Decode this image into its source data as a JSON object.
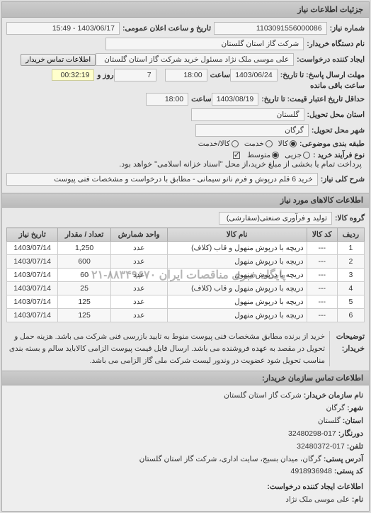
{
  "header": {
    "title": "جزئیات اطلاعات نیاز"
  },
  "info": {
    "number_label": "شماره نیاز:",
    "number": "1103091556000086",
    "pubdate_label": "تاریخ و ساعت اعلان عمومی:",
    "pubdate": "1403/06/17 - 15:49",
    "buyer_label": "نام دستگاه خریدار:",
    "buyer": "شرکت گاز استان گلستان",
    "requester_label": "ایجاد کننده درخواست:",
    "requester": "علی موسی ملک نژاد مسئول خرید شرکت گاز استان گلستان",
    "buyer_contact_btn": "اطلاعات تماس خریدار",
    "deadline_from_label": "مهلت ارسال پاسخ: تا تاریخ:",
    "deadline_date": "1403/06/24",
    "hour_label": "ساعت",
    "deadline_hour": "18:00",
    "days_remain": "7",
    "days_remain_label": "روز و",
    "countdown": "00:32:19",
    "countdown_label": "ساعت باقی مانده",
    "valid_label": "حداقل تاریخ اعتبار قیمت: تا تاریخ:",
    "valid_date": "1403/08/19",
    "valid_hour": "18:00",
    "province_label": "استان محل تحویل:",
    "province": "گلستان",
    "city_label": "شهر محل تحویل:",
    "city": "گرگان",
    "pack_label": "طبقه بندی موضوعی:",
    "pack_opts": {
      "all": "کالا",
      "goods": "خدمت",
      "service": "کالا/خدمت"
    },
    "buytype_label": "نوع فرآیند خرید :",
    "buytype_opts": {
      "small": "جزیی",
      "medium": "متوسط"
    },
    "buytype_note": "پرداخت تمام یا بخشی از مبلغ خرید،از محل \"اسناد خزانه اسلامی\" خواهد بود.",
    "summary_label": "شرح کلی نیاز:",
    "summary": "خرید 6 قلم درپوش و فرم نانو سیمانی - مطابق با درخواست و مشخصات فنی پیوست"
  },
  "goods": {
    "section_title": "اطلاعات کالاهای مورد نیاز",
    "group_label": "گروه کالا:",
    "group": "تولید و فرآوری صنعتی(سفارشی)",
    "columns": [
      "ردیف",
      "کد کالا",
      "نام کالا",
      "واحد شمارش",
      "تعداد / مقدار",
      "تاریخ نیاز"
    ],
    "rows": [
      {
        "n": "1",
        "code": "---",
        "name": "دریچه با درپوش منهول و قاب (کلاف)",
        "unit": "عدد",
        "qty": "1,250",
        "date": "1403/07/14"
      },
      {
        "n": "2",
        "code": "---",
        "name": "دریچه با درپوش منهول",
        "unit": "عدد",
        "qty": "600",
        "date": "1403/07/14"
      },
      {
        "n": "3",
        "code": "---",
        "name": "دریچه با درپوش منهول",
        "unit": "عدد",
        "qty": "60",
        "date": "1403/07/14"
      },
      {
        "n": "4",
        "code": "---",
        "name": "دریچه با درپوش منهول و قاب (کلاف)",
        "unit": "عدد",
        "qty": "25",
        "date": "1403/07/14"
      },
      {
        "n": "5",
        "code": "---",
        "name": "دریچه با درپوش منهول",
        "unit": "عدد",
        "qty": "125",
        "date": "1403/07/14"
      },
      {
        "n": "6",
        "code": "---",
        "name": "دریچه با درپوش منهول",
        "unit": "عدد",
        "qty": "125",
        "date": "1403/07/14"
      }
    ],
    "watermark": "پایگاه خبری مناقصات ایران ۸۸۳۴۹۶۷۰-۰۲۱"
  },
  "notes": {
    "label": "توضیحات خریدار:",
    "text": "خرید از برنده مطابق مشخصات فنی پیوست منوط به تایید بازرسی فنی شرکت می باشد. هزینه حمل و تحویل در مقصد به عهده فروشنده می باشد. ارسال فایل قیمت پیوست الزامی کالاباید سالم و بسته بندی مناسب تحویل شود عضویت در وندور لیست شرکت ملی گاز الزامی می باشد."
  },
  "contact": {
    "title": "اطلاعات تماس سازمان خریدار:",
    "org_label": "نام سازمان خریدار:",
    "org": "شرکت گاز استان گلستان",
    "city_label": "شهر:",
    "city": "گرگان",
    "province_label": "استان:",
    "province": "گلستان",
    "fax_label": "دورنگار:",
    "fax": "017-32480298",
    "phone_label": "تلفن:",
    "phone": "017-32480372",
    "addr_label": "آدرس پستی:",
    "addr": "گرگان، میدان بسیج، سایت اداری، شرکت گاز استان گلستان",
    "postal_label": "کد پستی:",
    "postal": "4918936948",
    "creator_title": "اطلاعات ایجاد کننده درخواست:",
    "creator_name_label": "نام:",
    "creator_name": "علی موسی ملک نژاد"
  }
}
